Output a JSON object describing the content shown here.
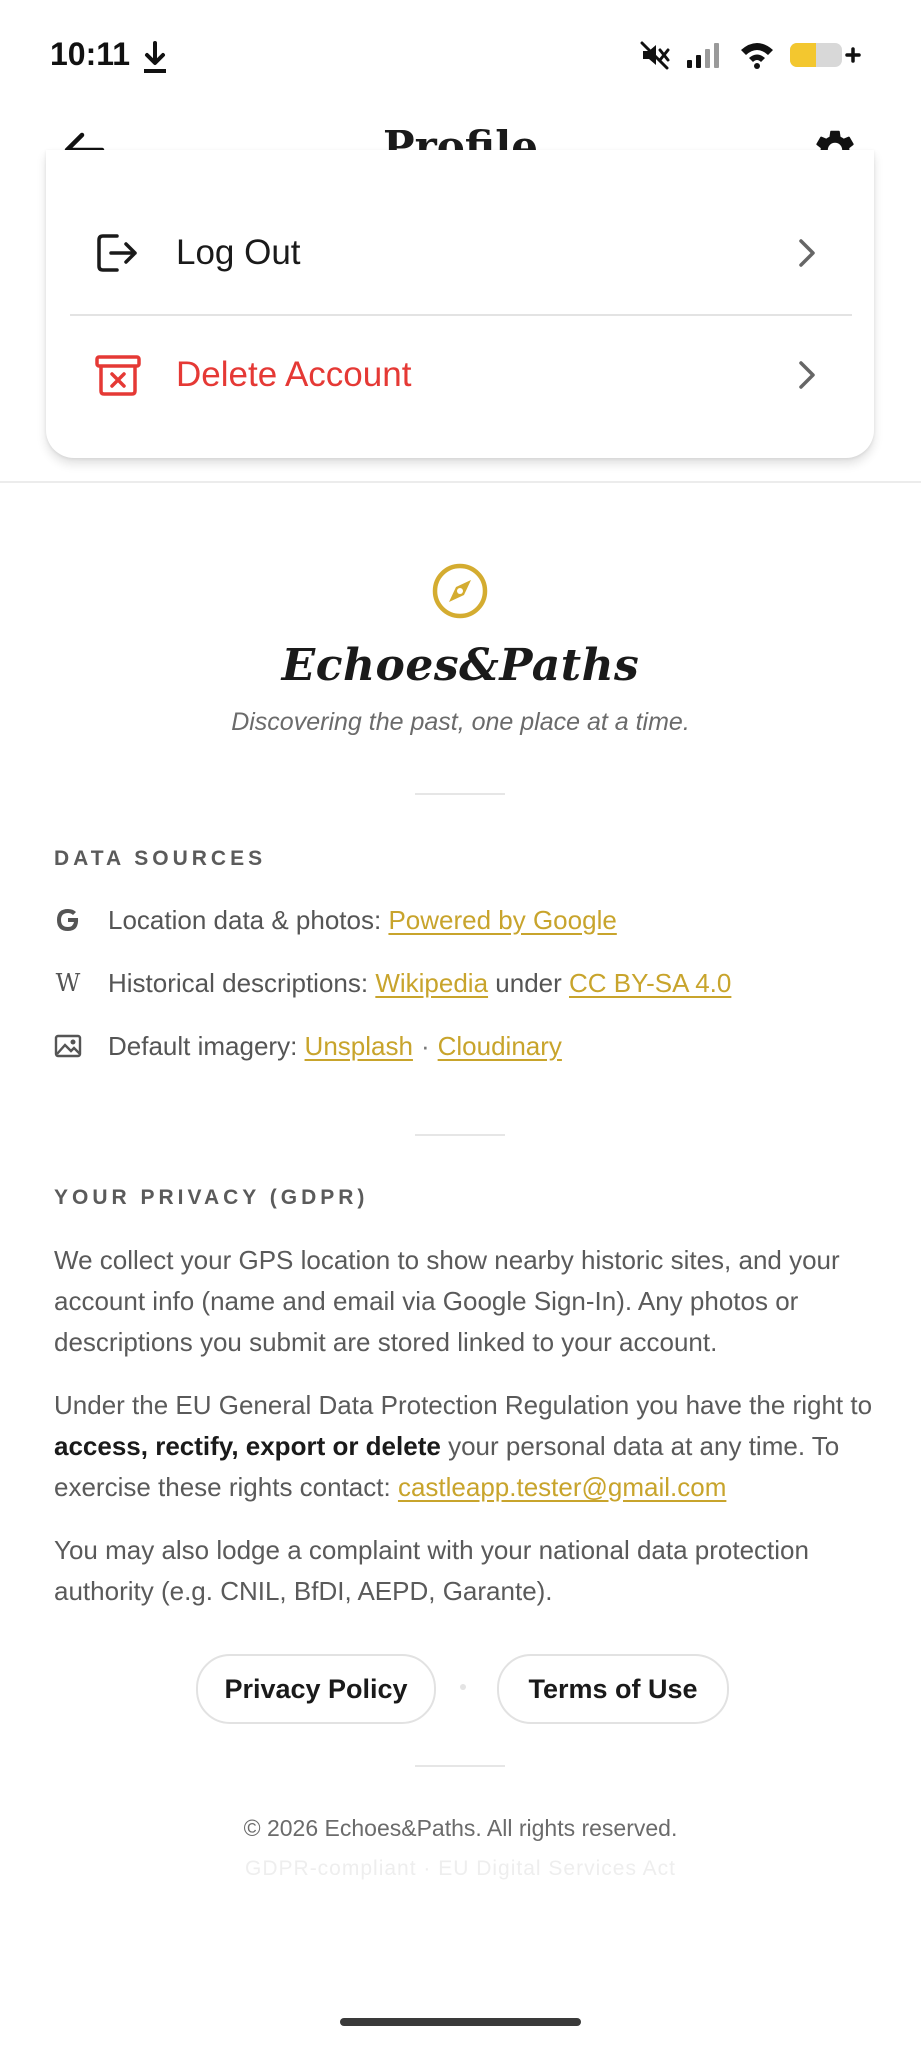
{
  "status_bar": {
    "time": "10:11",
    "icons": [
      "download-icon",
      "mute-icon",
      "signal-icon",
      "wifi-icon",
      "battery-icon"
    ]
  },
  "header": {
    "title": "Profile",
    "back_icon": "arrow-left-icon",
    "settings_icon": "gear-icon"
  },
  "account_actions": [
    {
      "label": "Log Out",
      "icon": "logout-icon",
      "color": "#1a1a1a"
    },
    {
      "label": "Delete Account",
      "icon": "trash-icon",
      "color": "#e53935"
    }
  ],
  "brand": {
    "name": "Echoes&Paths",
    "tagline": "Discovering the past, one place at a time.",
    "icon": "compass-icon",
    "accent_color": "#d4ac30"
  },
  "data_sources": {
    "heading": "DATA SOURCES",
    "location": {
      "text": "Location data & photos:",
      "link": "Powered by Google",
      "icon": "google-icon"
    },
    "historical": {
      "text": "Historical descriptions:",
      "link1": "Wikipedia",
      "mid": "under",
      "link2": "CC BY-SA 4.0",
      "icon": "wikipedia-icon"
    },
    "imagery": {
      "text": "Default imagery:",
      "link1": "Unsplash",
      "sep": "·",
      "link2": "Cloudinary",
      "icon": "image-icon"
    }
  },
  "privacy": {
    "heading": "YOUR PRIVACY (GDPR)",
    "p1": "We collect your GPS location to show nearby historic sites, and your account info (name and email via Google Sign-In). Any photos or descriptions you submit are stored linked to your account.",
    "p2_start": "Under the EU General Data Protection Regulation you have the right to",
    "p2_bold": "access, rectify, export or delete",
    "p2_end": "your personal data at any time. To exercise these rights contact:",
    "email": "castleapp.tester@gmail.com",
    "p3": "You may also lodge a complaint with your national data protection authority (e.g. CNIL, BfDI, AEPD, Garante)."
  },
  "legal_buttons": {
    "privacy_policy": "Privacy Policy",
    "terms": "Terms of Use"
  },
  "footer": {
    "copyright": "© 2026 Echoes&Paths. All rights reserved.",
    "compliance": "GDPR-compliant · EU Digital Services Act"
  }
}
